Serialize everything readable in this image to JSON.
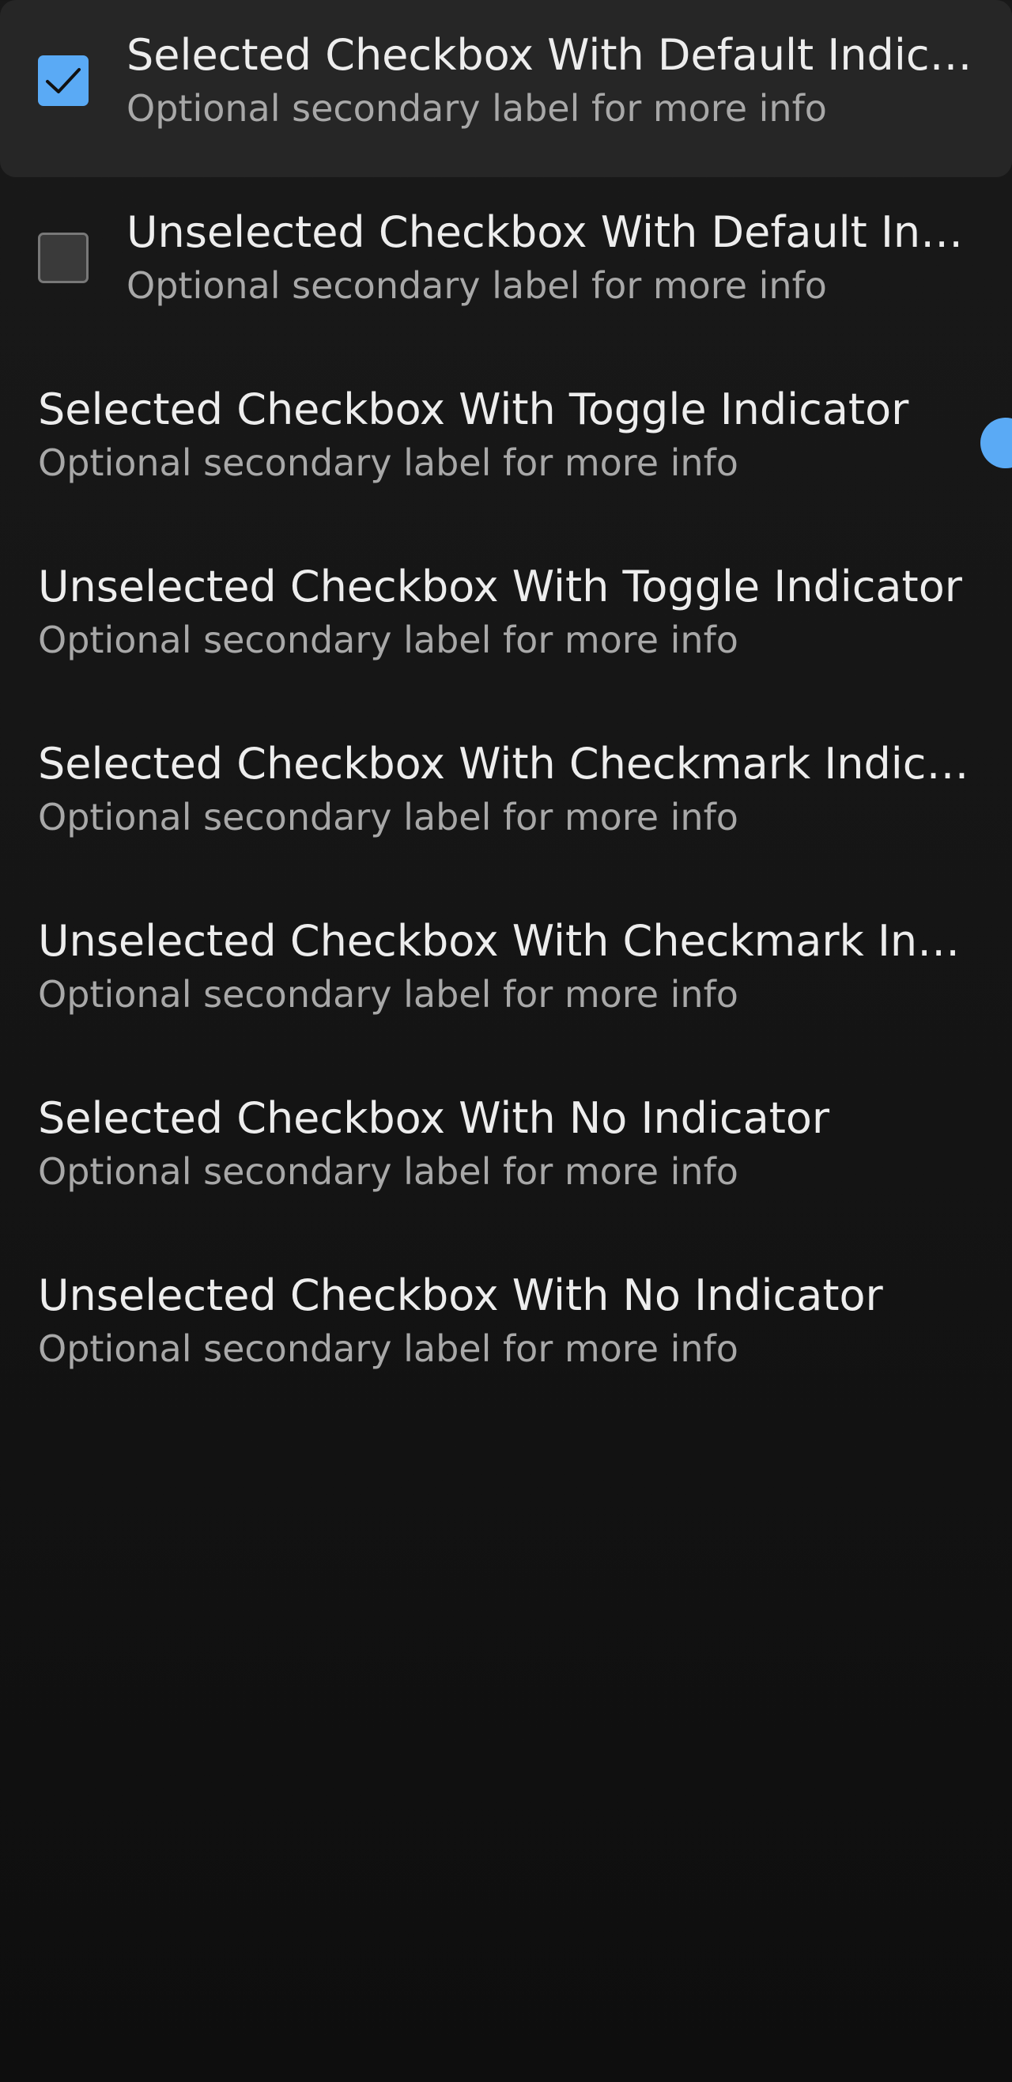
{
  "items": [
    {
      "label": "Selected Checkbox With Default Indicator",
      "secondary": "Optional secondary label for more info",
      "checked": true,
      "indicator": "default"
    },
    {
      "label": "Unselected Checkbox With Default Indicator",
      "secondary": "Optional secondary label for more info",
      "checked": false,
      "indicator": "default"
    },
    {
      "label": "Selected Checkbox With Toggle Indicator",
      "secondary": "Optional secondary label for more info",
      "checked": true,
      "indicator": "toggle"
    },
    {
      "label": "Unselected Checkbox With Toggle Indicator",
      "secondary": "Optional secondary label for more info",
      "checked": false,
      "indicator": "toggle"
    },
    {
      "label": "Selected Checkbox With Checkmark Indicator",
      "secondary": "Optional secondary label for more info",
      "checked": true,
      "indicator": "checkmark"
    },
    {
      "label": "Unselected Checkbox With Checkmark Indicator",
      "secondary": "Optional secondary label for more info",
      "checked": false,
      "indicator": "checkmark"
    },
    {
      "label": "Selected Checkbox With No Indicator",
      "secondary": "Optional secondary label for more info",
      "checked": true,
      "indicator": "none"
    },
    {
      "label": "Unselected Checkbox With No Indicator",
      "secondary": "Optional secondary label for more info",
      "checked": false,
      "indicator": "none"
    }
  ],
  "colors": {
    "accent": "#5aaaf5",
    "background": "#141414",
    "highlight": "#262626",
    "primary_text": "#ededed",
    "secondary_text": "#a8a8a8"
  }
}
